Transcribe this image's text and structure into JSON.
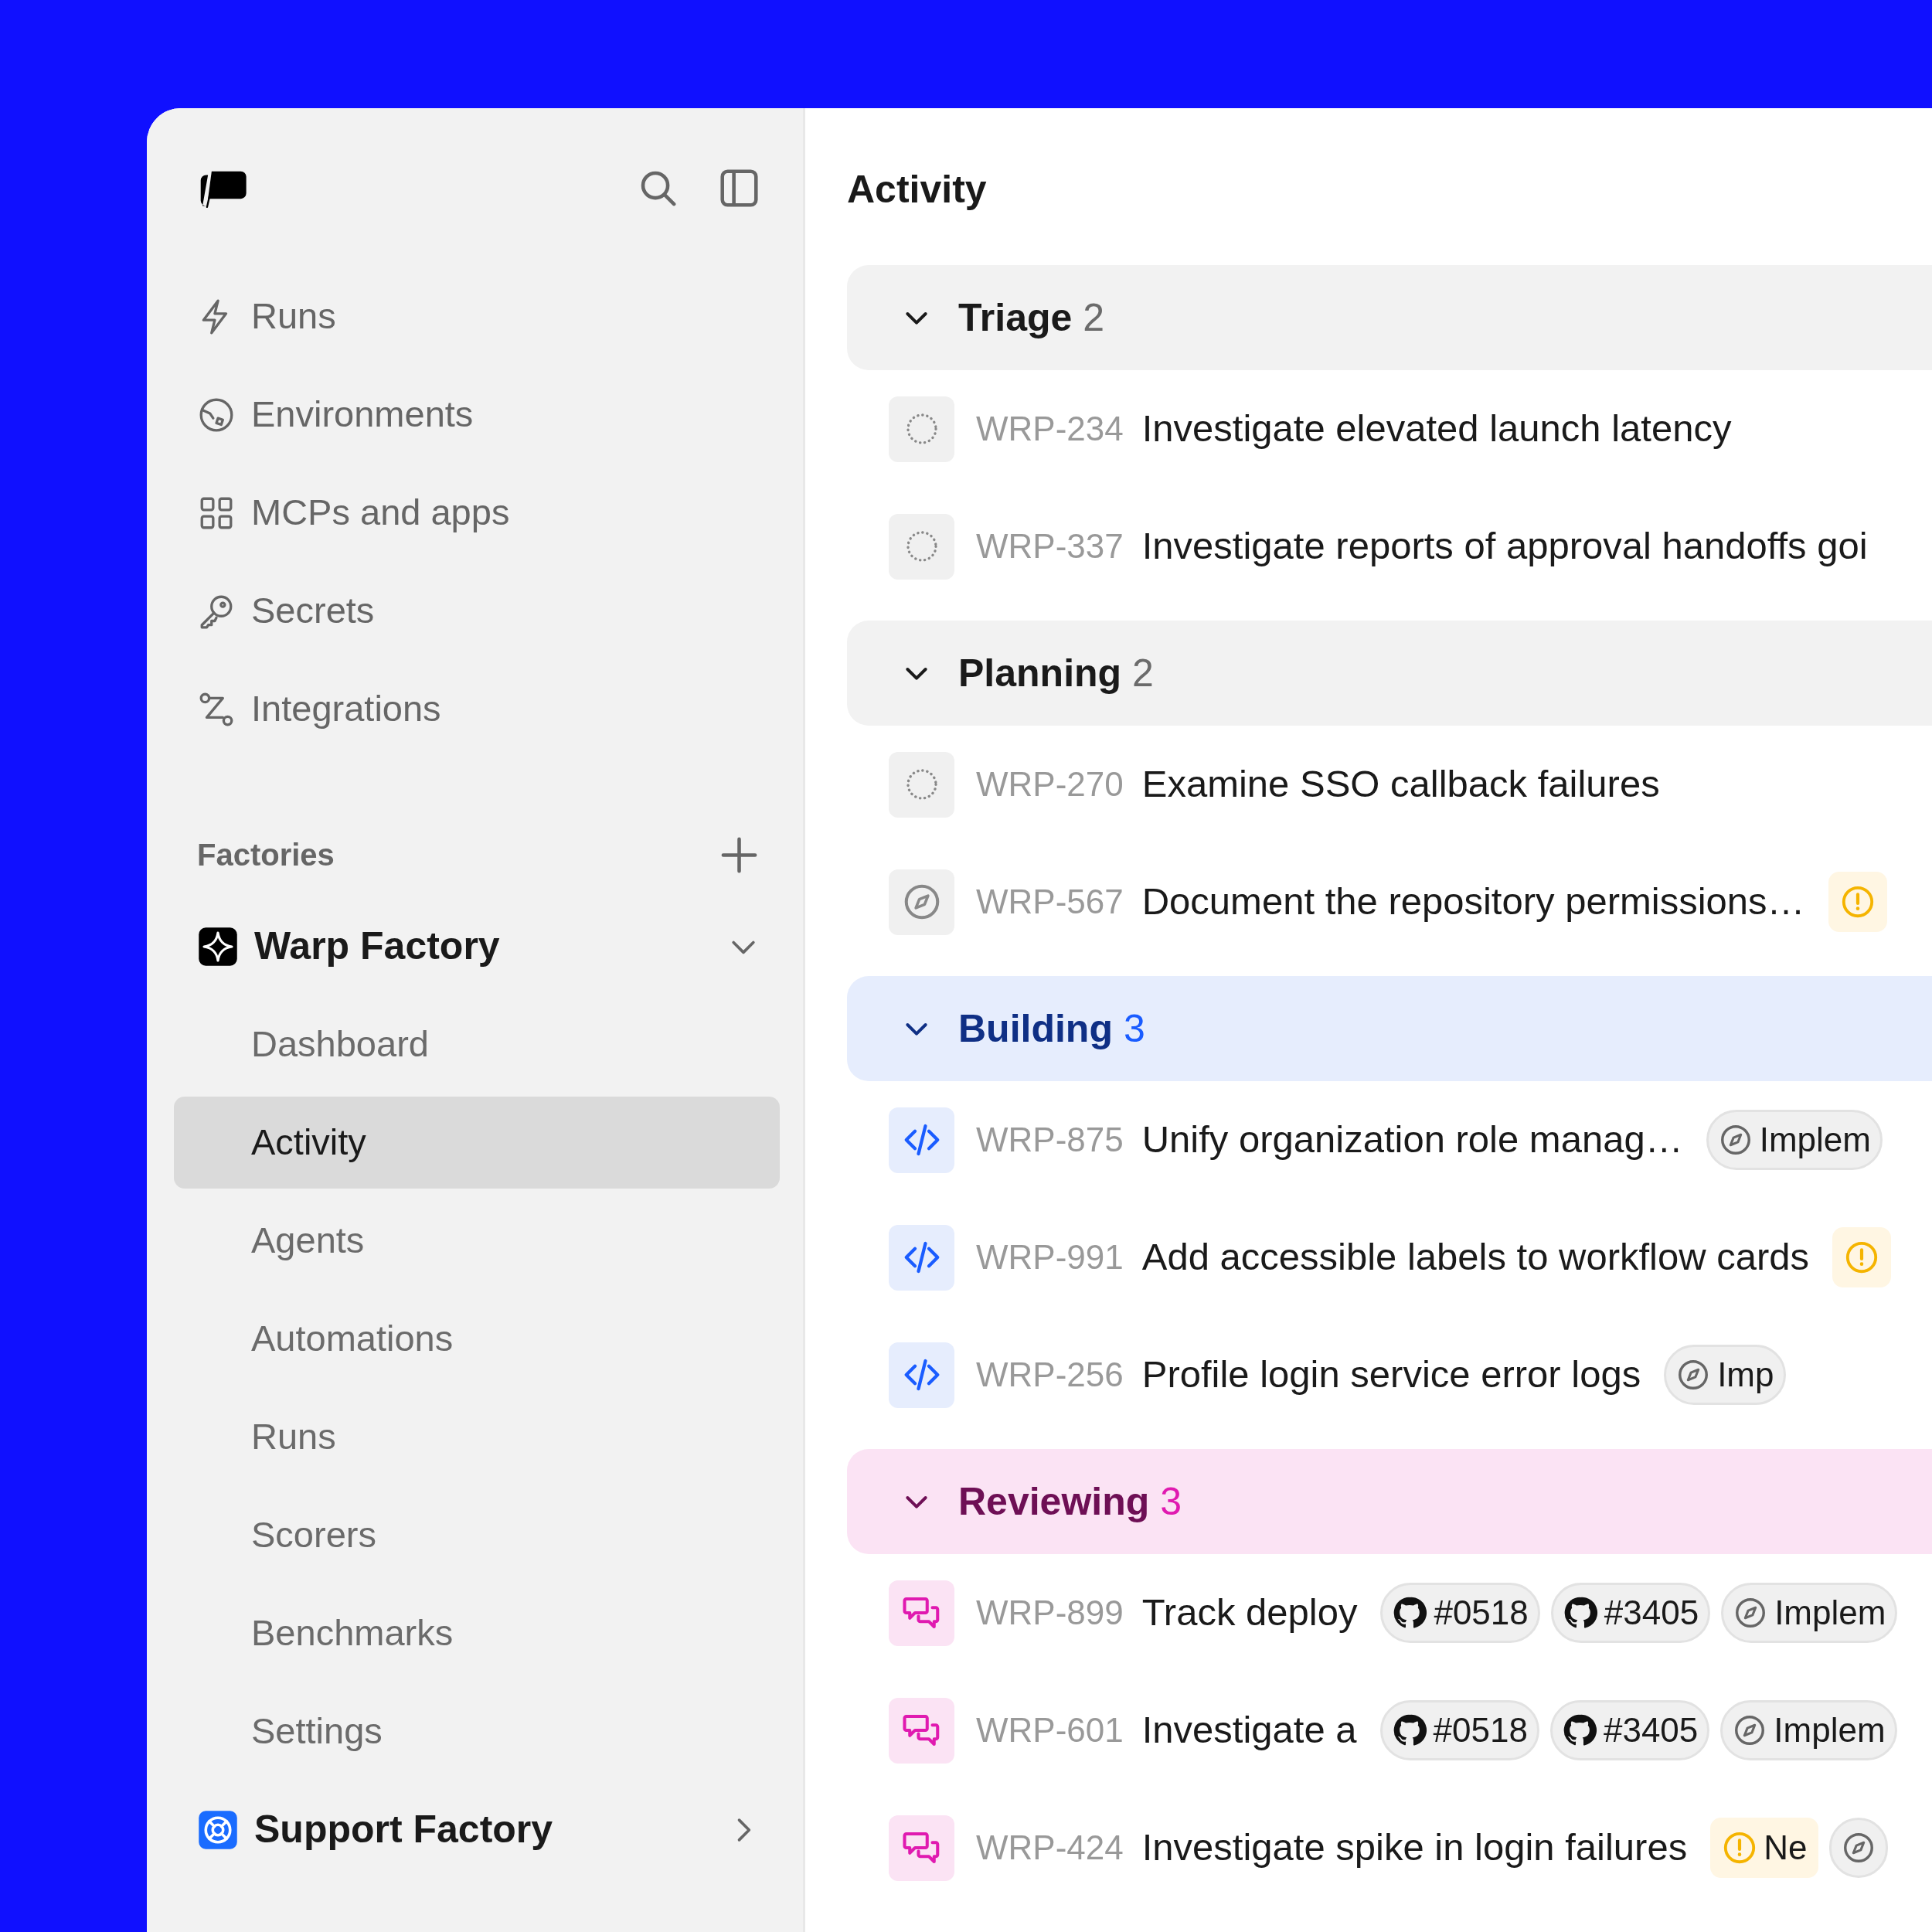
{
  "sidebar": {
    "nav": [
      {
        "kind": "runs",
        "label": "Runs"
      },
      {
        "kind": "environments",
        "label": "Environments"
      },
      {
        "kind": "apps",
        "label": "MCPs and apps"
      },
      {
        "kind": "secrets",
        "label": "Secrets"
      },
      {
        "kind": "integrations",
        "label": "Integrations"
      }
    ],
    "factories_heading": "Factories",
    "factories": [
      {
        "kind": "sparkle",
        "name": "Warp Factory",
        "expanded": true,
        "items": [
          {
            "label": "Dashboard",
            "selected": false
          },
          {
            "label": "Activity",
            "selected": true
          },
          {
            "label": "Agents",
            "selected": false
          },
          {
            "label": "Automations",
            "selected": false
          },
          {
            "label": "Runs",
            "selected": false
          },
          {
            "label": "Scorers",
            "selected": false
          },
          {
            "label": "Benchmarks",
            "selected": false
          },
          {
            "label": "Settings",
            "selected": false
          }
        ]
      },
      {
        "kind": "lifebuoy",
        "name": "Support Factory",
        "expanded": false
      }
    ]
  },
  "main": {
    "title": "Activity",
    "groups": [
      {
        "kind": "triage",
        "name": "Triage",
        "count": "2",
        "expanded": true,
        "rows": [
          {
            "kind": "pending",
            "id": "WRP-234",
            "title": "Investigate elevated launch latency"
          },
          {
            "kind": "pending",
            "id": "WRP-337",
            "title": "Investigate reports of approval handoffs goi"
          }
        ]
      },
      {
        "kind": "planning",
        "name": "Planning",
        "count": "2",
        "expanded": true,
        "rows": [
          {
            "kind": "pending",
            "id": "WRP-270",
            "title": "Examine SSO callback failures"
          },
          {
            "kind": "planning",
            "id": "WRP-567",
            "title": "Document the repository permissions…",
            "chips": [
              {
                "kind": "warning"
              }
            ]
          }
        ]
      },
      {
        "kind": "building",
        "name": "Building",
        "count": "3",
        "expanded": true,
        "rows": [
          {
            "kind": "building",
            "id": "WRP-875",
            "title": "Unify organization role manag…",
            "chips": [
              {
                "kind": "status",
                "label": "Implem"
              }
            ]
          },
          {
            "kind": "building",
            "id": "WRP-991",
            "title": "Add accessible labels to workflow cards",
            "chips": [
              {
                "kind": "warning"
              }
            ]
          },
          {
            "kind": "building",
            "id": "WRP-256",
            "title": "Profile login service error logs",
            "chips": [
              {
                "kind": "status",
                "label": "Imp"
              }
            ]
          }
        ]
      },
      {
        "kind": "reviewing",
        "name": "Reviewing",
        "count": "3",
        "expanded": true,
        "rows": [
          {
            "kind": "reviewing",
            "id": "WRP-899",
            "title": "Track deploy",
            "chips": [
              {
                "kind": "pr",
                "label": "#0518"
              },
              {
                "kind": "pr",
                "label": "#3405"
              },
              {
                "kind": "status",
                "label": "Implem"
              }
            ]
          },
          {
            "kind": "reviewing",
            "id": "WRP-601",
            "title": "Investigate a",
            "chips": [
              {
                "kind": "pr",
                "label": "#0518"
              },
              {
                "kind": "pr",
                "label": "#3405"
              },
              {
                "kind": "status",
                "label": "Implem"
              }
            ]
          },
          {
            "kind": "reviewing",
            "id": "WRP-424",
            "title": "Investigate spike in login failures",
            "chips": [
              {
                "kind": "warning",
                "label": "Ne"
              },
              {
                "kind": "status"
              }
            ]
          }
        ]
      }
    ]
  }
}
